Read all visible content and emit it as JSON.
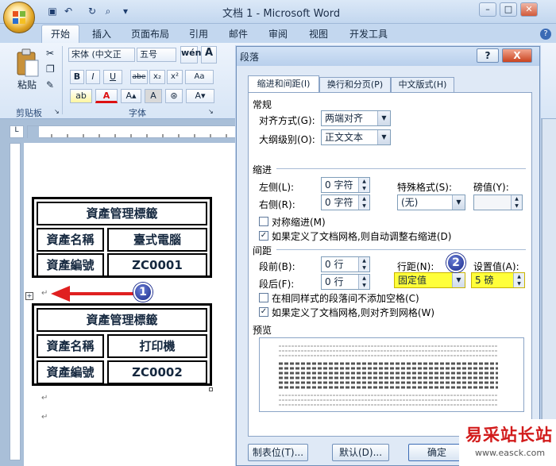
{
  "window": {
    "title": "文档 1 - Microsoft Word"
  },
  "tabs": [
    "开始",
    "插入",
    "页面布局",
    "引用",
    "邮件",
    "审阅",
    "视图",
    "开发工具"
  ],
  "ribbon": {
    "paste_label": "粘贴",
    "clipboard_group": "剪贴板",
    "font_group": "字体",
    "font_name": "宋体 (中文正文)",
    "font_size": "五号",
    "font_name_display": "宋体 (中文正",
    "font_buttons": [
      "B",
      "I",
      "U",
      "abe",
      "x₂",
      "x²",
      "Aa"
    ]
  },
  "document": {
    "table1": {
      "title": "資產管理標籤",
      "rows": [
        [
          "資產名稱",
          "臺式電腦"
        ],
        [
          "資產編號",
          "ZC0001"
        ]
      ]
    },
    "table2": {
      "title": "資產管理標籤",
      "rows": [
        [
          "資產名稱",
          "打印機"
        ],
        [
          "資產編號",
          "ZC0002"
        ]
      ]
    },
    "para_mark": "↵",
    "callout1": "1"
  },
  "dialog": {
    "title": "段落",
    "tabs": [
      "缩进和间距(I)",
      "换行和分页(P)",
      "中文版式(H)"
    ],
    "general_label": "常规",
    "alignment_label": "对齐方式(G):",
    "alignment_value": "两端对齐",
    "outline_label": "大纲级别(O):",
    "outline_value": "正文文本",
    "indent_label": "缩进",
    "left_label": "左侧(L):",
    "left_value": "0 字符",
    "right_label": "右侧(R):",
    "right_value": "0 字符",
    "special_label": "特殊格式(S):",
    "special_value": "(无)",
    "by_label": "磅值(Y):",
    "mirror_label": "对称缩进(M)",
    "auto_indent_label": "如果定义了文档网格,则自动调整右缩进(D)",
    "spacing_label": "间距",
    "before_label": "段前(B):",
    "before_value": "0 行",
    "after_label": "段后(F):",
    "after_value": "0 行",
    "line_spacing_label": "行距(N):",
    "line_spacing_value": "固定值",
    "at_label": "设置值(A):",
    "at_value": "5 磅",
    "no_space_label": "在相同样式的段落间不添加空格(C)",
    "snap_grid_label": "如果定义了文档网格,则对齐到网格(W)",
    "preview_label": "预览",
    "tabs_button": "制表位(T)...",
    "default_button": "默认(D)...",
    "ok_button": "确定",
    "callout2": "2",
    "help": "?",
    "close": "X"
  },
  "watermark": {
    "line1": "易采站长站",
    "line2": "www.easck.com"
  }
}
